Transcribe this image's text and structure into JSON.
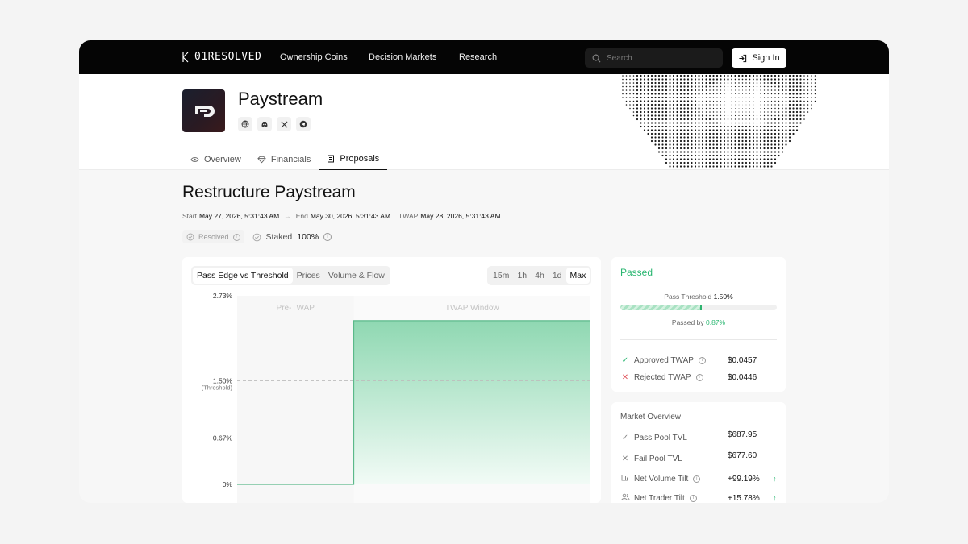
{
  "nav": {
    "logo": "01RESOLVED",
    "links": [
      "Ownership Coins",
      "Decision Markets",
      "Research"
    ],
    "search_placeholder": "Search",
    "signin_label": "Sign In"
  },
  "project": {
    "name": "Paystream",
    "social_icons": [
      "globe-icon",
      "discord-icon",
      "x-icon",
      "telegram-icon"
    ],
    "tabs": [
      {
        "label": "Overview",
        "icon": "eye-icon",
        "active": false
      },
      {
        "label": "Financials",
        "icon": "diamond-icon",
        "active": false
      },
      {
        "label": "Proposals",
        "icon": "scroll-icon",
        "active": true
      }
    ]
  },
  "proposal": {
    "title": "Restructure Paystream",
    "start_label": "Start",
    "start": "May 27, 2026, 5:31:43 AM",
    "end_label": "End",
    "end": "May 30, 2026, 5:31:43 AM",
    "twap_label": "TWAP",
    "twap": "May 28, 2026, 5:31:43 AM",
    "resolved_label": "Resolved",
    "staked_label": "Staked",
    "staked_value": "100%"
  },
  "chart_tabs": [
    "Pass Edge vs Threshold",
    "Prices",
    "Volume & Flow"
  ],
  "chart_active_tab": "Pass Edge vs Threshold",
  "range_tabs": [
    "15m",
    "1h",
    "4h",
    "1d",
    "Max"
  ],
  "range_active": "Max",
  "chart_data": {
    "type": "area",
    "regions": [
      "Pre-TWAP",
      "TWAP Window"
    ],
    "y_ticks": [
      "2.73%",
      "1.50%",
      "0.67%",
      "0%"
    ],
    "threshold_label": "(Threshold)",
    "threshold": 1.5,
    "ylim": [
      0,
      2.73
    ],
    "x": [
      0,
      1,
      1,
      2
    ],
    "values": [
      0,
      0,
      2.37,
      2.37
    ],
    "pre_twap_end_fraction": 0.33,
    "colors": {
      "line": "#5bb98a",
      "fill_top": "#8fd8b2",
      "fill_bottom": "#f2fbf6",
      "threshold": "#bdbdbd"
    }
  },
  "pass_panel": {
    "status": "Passed",
    "threshold_label": "Pass Threshold",
    "threshold_value": "1.50%",
    "fill_fraction": 0.52,
    "passed_by_label": "Passed by",
    "passed_by_value": "0.87%",
    "rows": [
      {
        "label": "Approved TWAP",
        "value": "$0.0457",
        "icon": "check-icon"
      },
      {
        "label": "Rejected TWAP",
        "value": "$0.0446",
        "icon": "x-icon"
      }
    ]
  },
  "market_overview": {
    "title": "Market Overview",
    "rows": [
      {
        "label": "Pass Pool TVL",
        "value": "$687.95",
        "icon": "check-icon",
        "info": false,
        "up": false
      },
      {
        "label": "Fail Pool TVL",
        "value": "$677.60",
        "icon": "x-icon",
        "info": false,
        "up": false
      },
      {
        "label": "Net Volume Tilt",
        "value": "+99.19%",
        "icon": "bar-chart-icon",
        "info": true,
        "up": true
      },
      {
        "label": "Net Trader Tilt",
        "value": "+15.78%",
        "icon": "users-icon",
        "info": true,
        "up": true
      }
    ]
  },
  "colors": {
    "accent_green": "#28b670",
    "danger": "#e0525a"
  }
}
